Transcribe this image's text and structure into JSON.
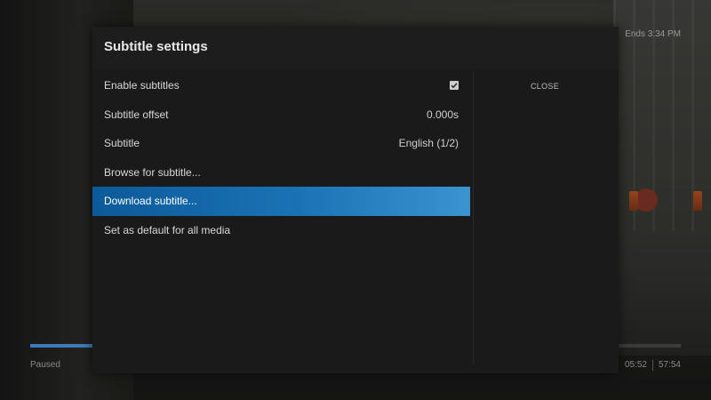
{
  "player": {
    "ends_text": "Ends 3:34 PM",
    "status": "Paused",
    "elapsed": "05:52",
    "total": "57:54",
    "progress": 0.1
  },
  "dialog": {
    "title": "Subtitle settings",
    "close_label": "CLOSE",
    "items": [
      {
        "label": "Enable subtitles",
        "value": "",
        "checked": true
      },
      {
        "label": "Subtitle offset",
        "value": "0.000s"
      },
      {
        "label": "Subtitle",
        "value": "English (1/2)"
      },
      {
        "label": "Browse for subtitle...",
        "value": ""
      },
      {
        "label": "Download subtitle...",
        "value": "",
        "selected": true
      },
      {
        "label": "Set as default for all media",
        "value": ""
      }
    ]
  },
  "colors": {
    "selection_start": "#0c5a9a",
    "selection_end": "#3b93d0",
    "dialog_bg": "#1d1d1d"
  },
  "icons": {
    "checkbox": "checkmark-icon"
  }
}
